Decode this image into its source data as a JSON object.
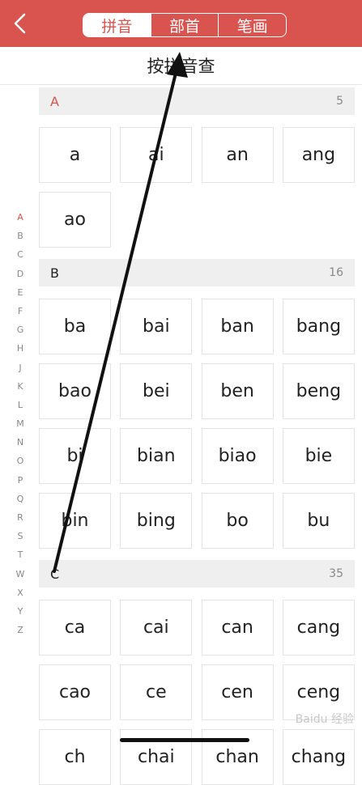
{
  "header": {
    "back_icon": "chevron-left-icon",
    "tabs": [
      "拼音",
      "部首",
      "笔画"
    ],
    "active_tab": 0
  },
  "subtitle": "按拼音查",
  "index_letters": [
    "A",
    "B",
    "C",
    "D",
    "E",
    "F",
    "G",
    "H",
    "J",
    "K",
    "L",
    "M",
    "N",
    "O",
    "P",
    "Q",
    "R",
    "S",
    "T",
    "W",
    "X",
    "Y",
    "Z"
  ],
  "sections": [
    {
      "letter": "A",
      "count": "5",
      "items": [
        "a",
        "ai",
        "an",
        "ang",
        "ao"
      ]
    },
    {
      "letter": "B",
      "count": "16",
      "items": [
        "ba",
        "bai",
        "ban",
        "bang",
        "bao",
        "bei",
        "ben",
        "beng",
        "bi",
        "bian",
        "biao",
        "bie",
        "bin",
        "bing",
        "bo",
        "bu"
      ]
    },
    {
      "letter": "C",
      "count": "35",
      "items": [
        "ca",
        "cai",
        "can",
        "cang",
        "cao",
        "ce",
        "cen",
        "ceng",
        "ch",
        "chai",
        "chan",
        "chang"
      ]
    }
  ],
  "watermark": "Baidu 经验",
  "colors": {
    "accent": "#d9534f",
    "section_bg": "#efefef"
  }
}
